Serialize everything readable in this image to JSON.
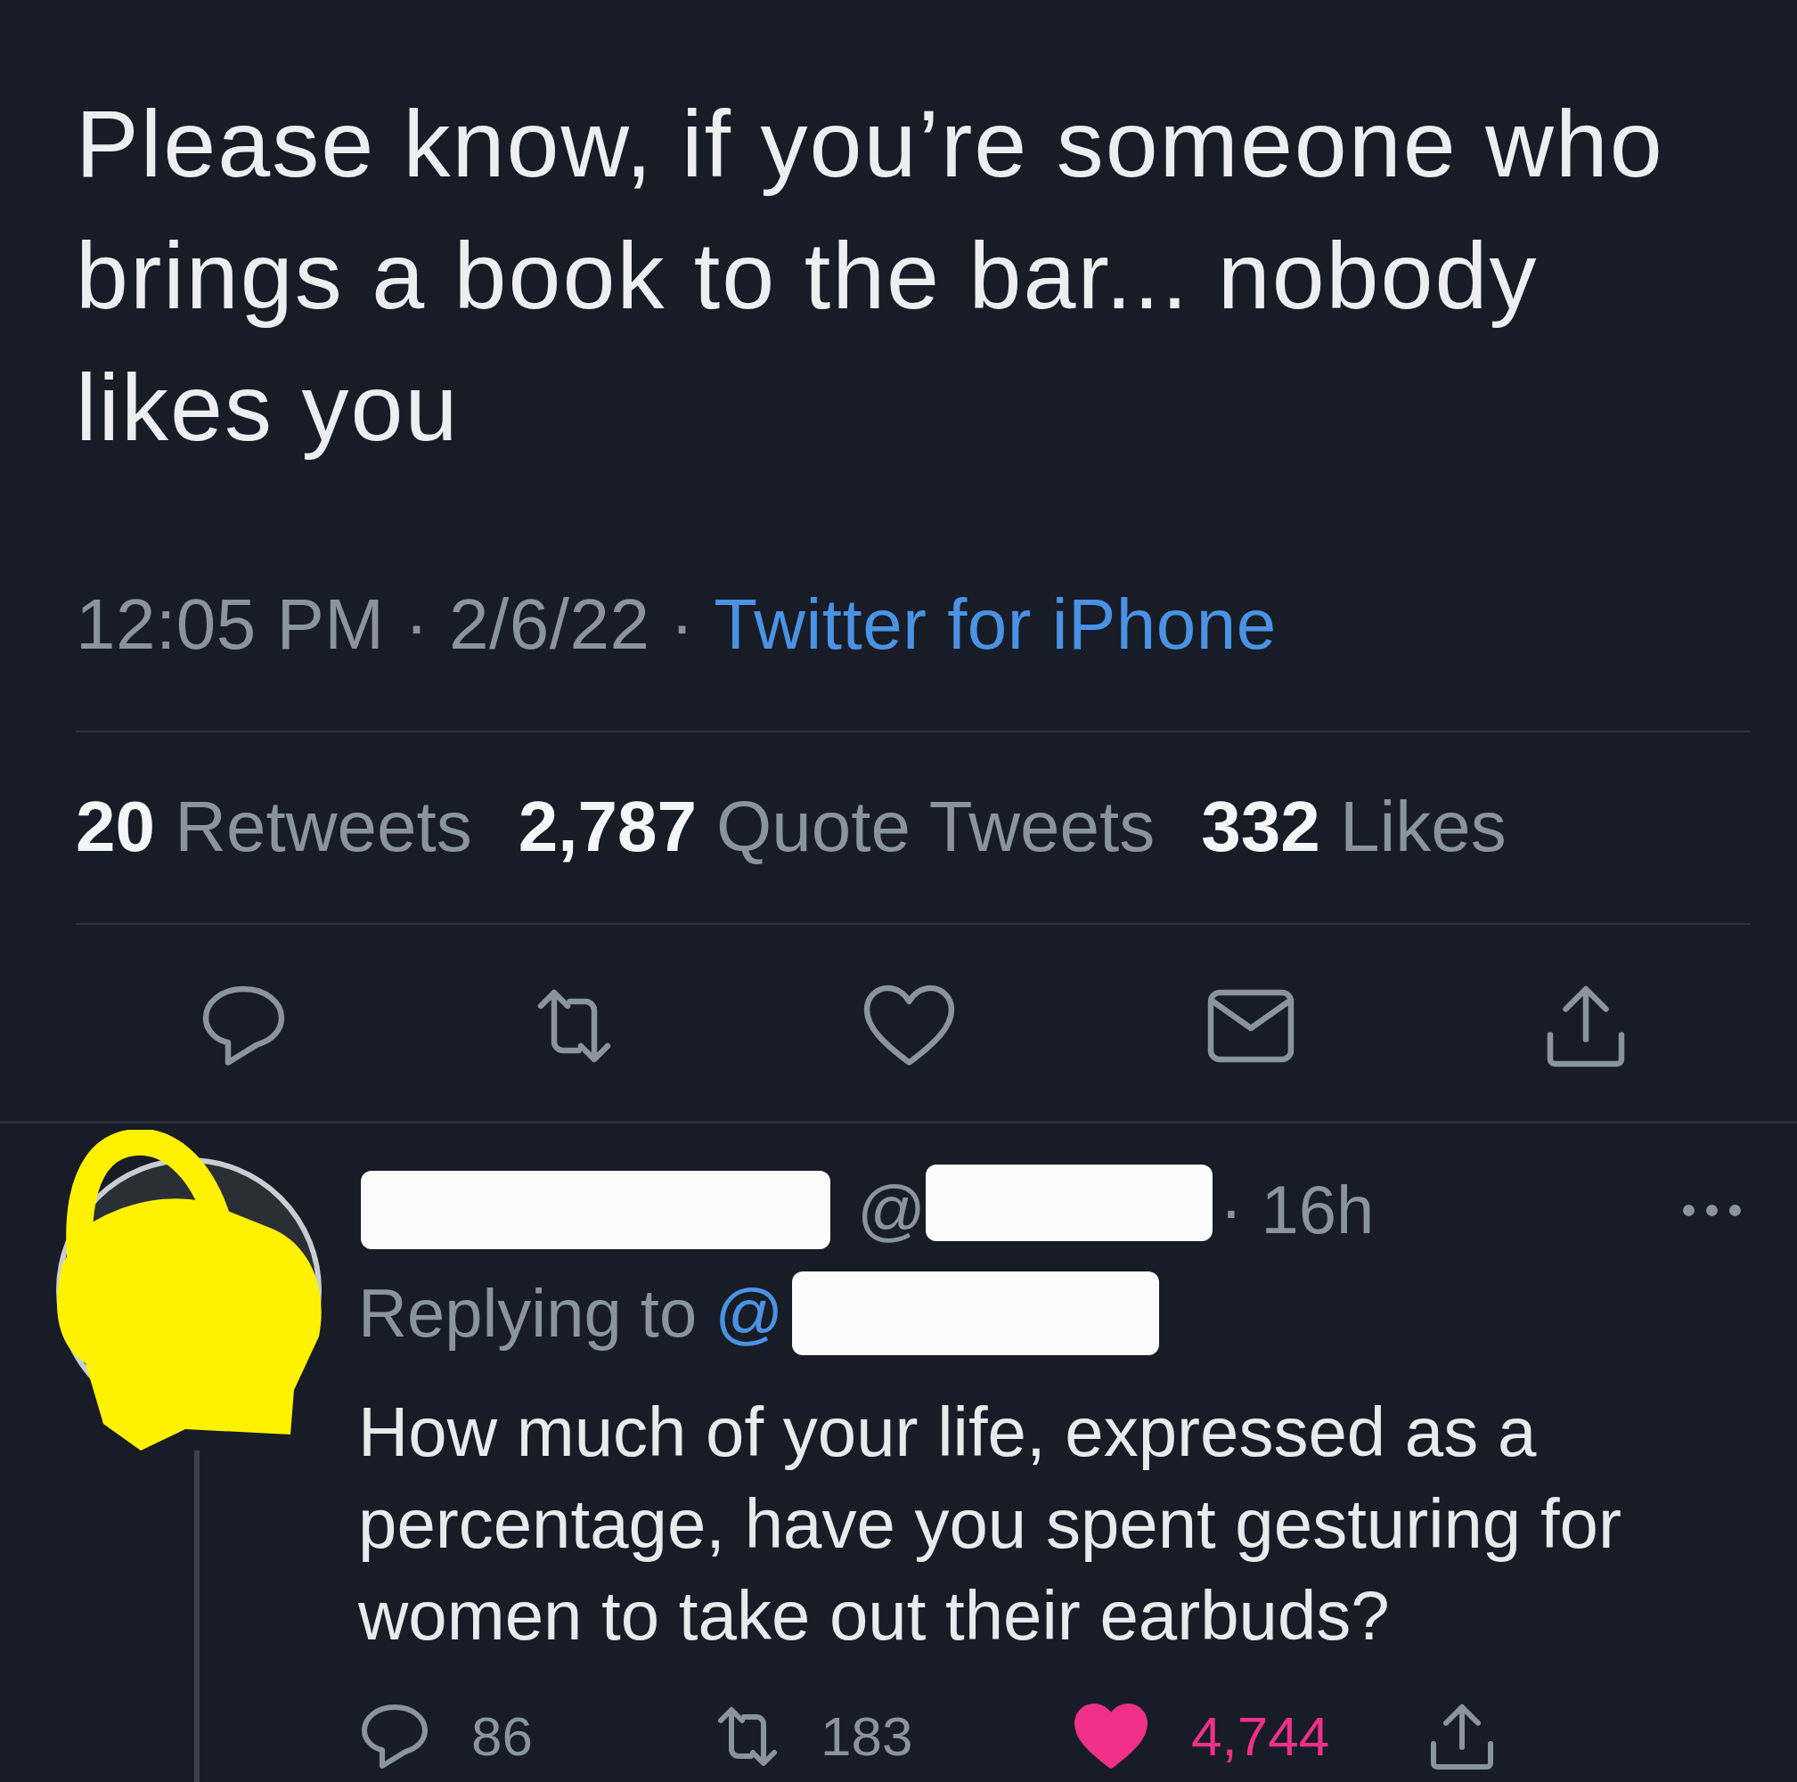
{
  "tweet": {
    "text": "Please know, if you’re someone who brings a book to the bar... nobody likes you",
    "timestamp": "12:05 PM · 2/6/22 ·",
    "source": "Twitter for iPhone",
    "stats": [
      {
        "count": "20",
        "label": "Retweets"
      },
      {
        "count": "2,787",
        "label": "Quote Tweets"
      },
      {
        "count": "332",
        "label": "Likes"
      }
    ],
    "actions": [
      {
        "kind": "reply",
        "active": false
      },
      {
        "kind": "retweet",
        "active": false
      },
      {
        "kind": "like",
        "active": false
      },
      {
        "kind": "message",
        "active": false
      },
      {
        "kind": "share",
        "active": false
      }
    ]
  },
  "reply": {
    "handle_prefix": "@",
    "time": "· 16h",
    "replying_to": "Replying to",
    "mention_prefix": "@",
    "text": "How much of your life, expressed as a percentage, have you spent gesturing for women to take out their earbuds?",
    "actions": [
      {
        "kind": "reply",
        "count": "86",
        "active": false
      },
      {
        "kind": "retweet",
        "count": "183",
        "active": false
      },
      {
        "kind": "like",
        "count": "4,744",
        "active": true
      },
      {
        "kind": "share",
        "active": false
      }
    ]
  }
}
